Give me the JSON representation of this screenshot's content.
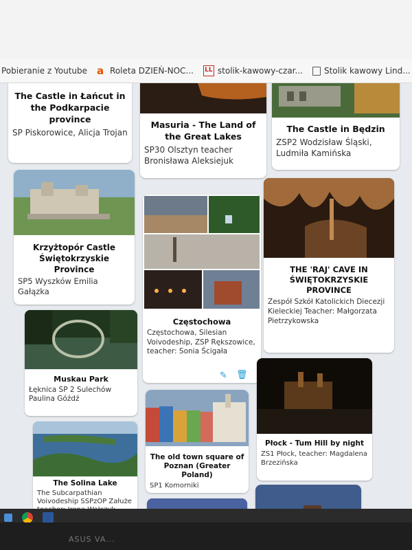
{
  "bookmarks": [
    {
      "label": "Pobieranie z Youtube",
      "icon": "none"
    },
    {
      "label": "Roleta DZIEŃ-NOC...",
      "icon": "letter-a-icon"
    },
    {
      "label": "stolik-kawowy-czar...",
      "icon": "ll-logo-icon"
    },
    {
      "label": "Stolik kawowy Lind...",
      "icon": "document-icon"
    }
  ],
  "cards": [
    {
      "title": "The Castle in Łańcut in the Podkarpacie province",
      "desc": "SP Piskorowice, Alicja Trojan"
    },
    {
      "title": "Masuria - The Land of the Great Lakes",
      "desc": "SP30 Olsztyn teacher Bronisława Aleksiejuk"
    },
    {
      "title": "The Castle in Będzin",
      "desc": "ZSP2 Wodzisław Śląski, Ludmiła Kamińska"
    },
    {
      "title": "Krzyżtopór Castle Świętokrzyskie Province",
      "desc": "SP5 Wyszków Emilia Gałązka"
    },
    {
      "title": "Częstochowa",
      "desc": "Częstochowa, Silesian Voivodeship, ZSP Rększowice, teacher: Sonia Ścigała"
    },
    {
      "title": "THE 'RAJ' CAVE IN ŚWIĘTOKRZYSKIE PROVINCE",
      "desc": "Zespół Szkół Katolickich Diecezji Kieleckiej Teacher: Małgorzata Pietrzykowska"
    },
    {
      "title": "Muskau Park",
      "desc": "Łęknica SP 2 Sulechów Paulina Góźdź"
    },
    {
      "title": "The old town square of Poznan (Greater Poland)",
      "desc": "SP1 Komorniki"
    },
    {
      "title": "Płock - Tum Hill by night",
      "desc": "ZS1 Płock, teacher: Magdalena Brzezińska"
    },
    {
      "title": "The Solina Lake",
      "desc": "The Subcarpathian Voivodeship SSPzOP Załuże teacher: Irena Wałczyk"
    }
  ],
  "taskbar": {
    "monitor_label": "ASUS VA..."
  },
  "colors": {
    "accent": "#1a9ad6",
    "board": "#e7eaee",
    "card": "#ffffff"
  }
}
